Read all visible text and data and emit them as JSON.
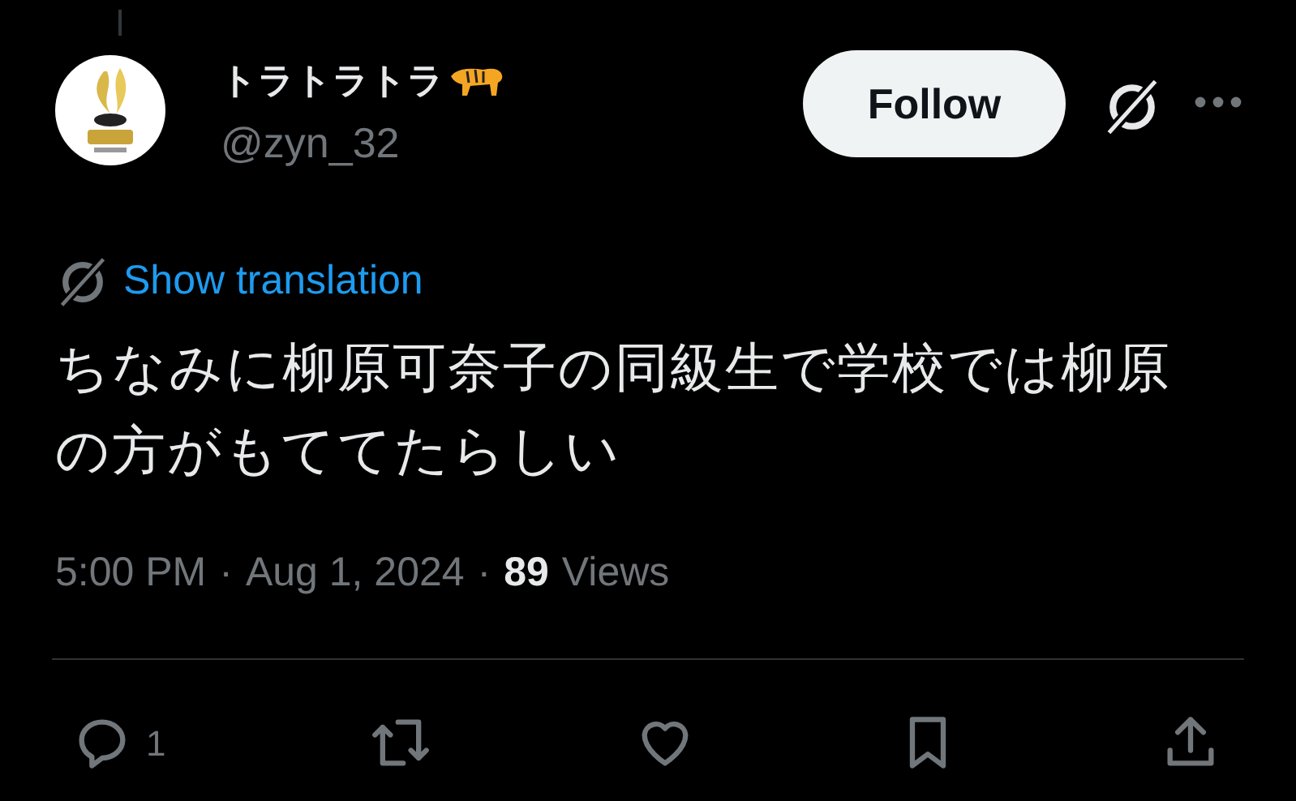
{
  "author": {
    "name": "トラトラトラ",
    "handle": "@zyn_32"
  },
  "follow_button": {
    "label": "Follow"
  },
  "translation_link": "Show translation",
  "body": "ちなみに柳原可奈子の同級生で学校では柳原の方がもててたらしい",
  "meta": {
    "separator": "·",
    "time": "5:00 PM",
    "date": "Aug 1, 2024",
    "views_count": "89",
    "views_label": "Views"
  },
  "actions": [
    {
      "kind": "reply",
      "count": "1"
    },
    {
      "kind": "repost"
    },
    {
      "kind": "like"
    },
    {
      "kind": "bookmark"
    },
    {
      "kind": "share"
    }
  ]
}
